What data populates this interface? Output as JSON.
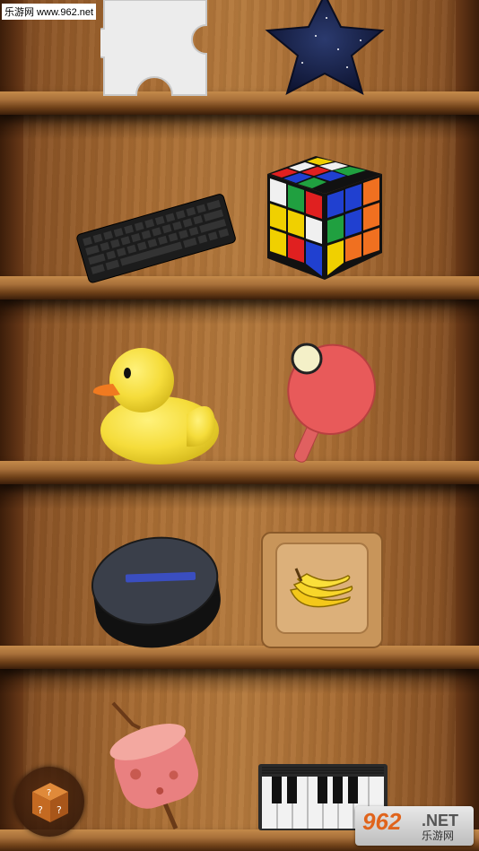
{
  "watermark": {
    "top_left": "乐游网 www.962.net",
    "badge_number": "962",
    "badge_suffix": ".NET",
    "badge_cn": "乐游网"
  },
  "shelves": [
    {
      "items": [
        "puzzle-piece",
        "star"
      ]
    },
    {
      "items": [
        "keyboard",
        "rubiks-cube"
      ]
    },
    {
      "items": [
        "rubber-duck",
        "ping-pong-paddle"
      ]
    },
    {
      "items": [
        "hockey-puck",
        "banana-tile"
      ]
    },
    {
      "items": [
        "marshmallow-stick",
        "piano-keyboard"
      ]
    }
  ],
  "colors": {
    "wood_light": "#b57a3d",
    "wood_dark": "#5a2f14",
    "accent_orange": "#e0641c"
  },
  "controls": {
    "dice_icon": "dice-question-icon"
  }
}
